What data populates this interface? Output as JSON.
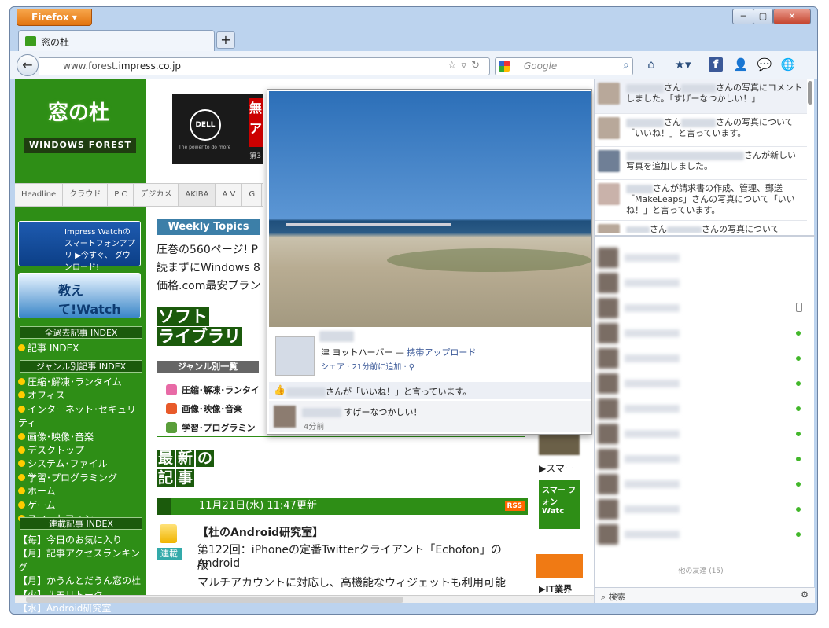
{
  "window": {
    "menu_label": "Firefox ▾",
    "min": "─",
    "max": "▢",
    "close": "✕"
  },
  "tab": {
    "title": "窓の杜",
    "new_tab": "+"
  },
  "nav": {
    "back": "←",
    "url_host": "www.forest.",
    "url_domain": "impress.co.jp",
    "url_icons": "☆▿↻",
    "search_placeholder": "Google",
    "search_go": "⌕",
    "toolbar_icons": [
      "⌂",
      "★▾",
      "f",
      "👤",
      "💬",
      "🌐"
    ]
  },
  "left": {
    "logo_main": "窓の杜",
    "logo_sub": "WINDOWS FOREST",
    "banner1": "Impress Watchの スマートフォンアプリ ▶今すぐ、 ダウンロード!",
    "banner2": "教えて!Watch",
    "banner2_sub": "Q&Aコミュニティ",
    "head1": "全過去記事 INDEX",
    "list1": [
      "記事 INDEX"
    ],
    "head2": "ジャンル別記事 INDEX",
    "list2": [
      "圧縮･解凍･ランタイム",
      "オフィス",
      "インターネット･セキュリティ",
      "画像･映像･音楽",
      "デスクトップ",
      "システム･ファイル",
      "学習･プログラミング",
      "ホーム",
      "ゲーム",
      "スマートフォン"
    ],
    "head3": "連載記事 INDEX",
    "list3": [
      "【毎】今日のお気に入り",
      "【月】記事アクセスランキング",
      "【月】かうんとだうん窓の杜",
      "【火】＃モリトーク",
      "【水】Android研究室"
    ]
  },
  "ad": {
    "brand": "DELL",
    "tagline": "The power to do more",
    "headline": "無\nア",
    "sub": "第3"
  },
  "navtabs": [
    "Headline",
    "クラウド",
    "P C",
    "デジカメ",
    "AKIBA",
    "A V",
    "G"
  ],
  "main": {
    "weekly_title": "Weekly Topics",
    "weekly_lines": [
      "圧巻の560ページ! P",
      "読まずにWindows 8",
      "価格.com最安プラン"
    ],
    "software_title": [
      "ソフト",
      "ライブラリ"
    ],
    "genre_title": "ジャンル別一覧",
    "genres": [
      "圧縮･解凍･ランタイ",
      "画像･映像･音楽",
      "学習･プログラミン"
    ],
    "latest_title": [
      "最",
      "新",
      "の",
      "記",
      "事"
    ],
    "date_line": "11月21日(水)  11:47更新",
    "rss": "RSS",
    "series_badge": "連載",
    "article_series": "【杜のAndroid研究室】",
    "article_title1": "第122回：iPhoneの定番Twitterクライアント「Echofon」のAndroid",
    "article_title2": "版",
    "article_desc": "マルチアカウントに対応し、高機能なウィジェットも利用可能",
    "right_link1": "スマー",
    "right_banner": "スマー フォン Watc",
    "right_link2": "IT業界"
  },
  "popup": {
    "location": "津  ヨットハーバー — ",
    "upload_via": "携帯アップロード",
    "meta": "シェア · 21分前に追加 · ⚲",
    "like_text": "さんが「いいね！」と言っています。",
    "comment_text": "すげーなつかしい！",
    "comment_time": "4分前"
  },
  "sidebar": {
    "notifications": [
      {
        "a": "さん",
        "b": "さんの写真にコメントしました。「すげーなつかしい！」"
      },
      {
        "a": "さん",
        "b": "さんの写真について「いいね！」と言っています。"
      },
      {
        "a": "",
        "b": "さんが新しい写真を追加しました。"
      },
      {
        "a": "",
        "b": "さんが請求書の作成、管理、郵送「MakeLeaps」さんの写真について「いいね！」と言っています。"
      },
      {
        "a": "さん",
        "b": "さんの写真について"
      }
    ],
    "others_label": "他の友達 (15)",
    "search": "検索",
    "gear": "⚙"
  },
  "colors": {
    "brand_green": "#2e8e16",
    "dark_green": "#1b5a0c",
    "fb_blue": "#3b5998",
    "firefox_orange": "#e2740f"
  }
}
